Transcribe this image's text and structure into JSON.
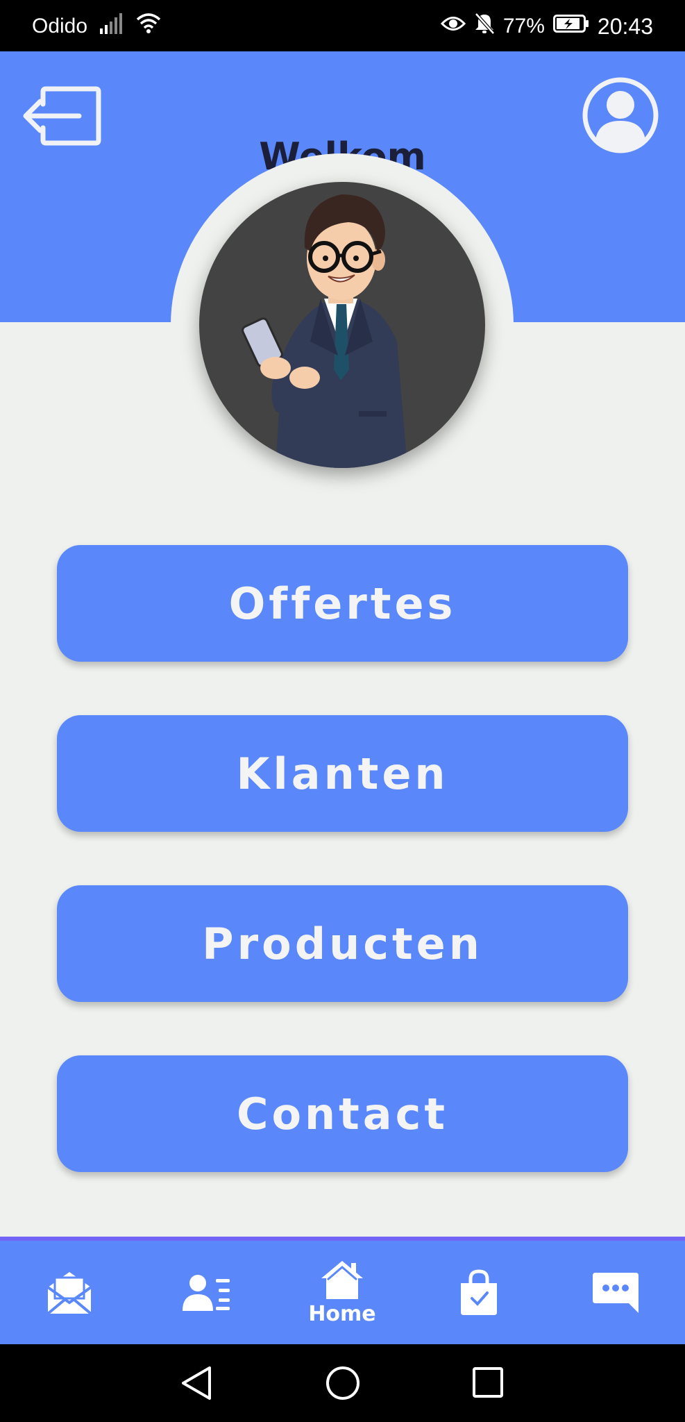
{
  "status_bar": {
    "carrier": "Odido",
    "battery": "77%",
    "time": "20:43",
    "icons": [
      "signal-icon",
      "wifi-icon",
      "eye-icon",
      "bell-off-icon",
      "battery-charging-icon"
    ]
  },
  "header": {
    "title": "Welkom",
    "logout_icon": "logout-icon",
    "profile_icon": "profile-icon",
    "background": "#5a88fa"
  },
  "menu": {
    "items": [
      {
        "label": "Offertes"
      },
      {
        "label": "Klanten"
      },
      {
        "label": "Producten"
      },
      {
        "label": "Contact"
      }
    ]
  },
  "bottom_nav": {
    "items": [
      {
        "icon": "mail-open-icon",
        "label": ""
      },
      {
        "icon": "contacts-list-icon",
        "label": ""
      },
      {
        "icon": "home-icon",
        "label": "Home",
        "active": true
      },
      {
        "icon": "shopping-bag-check-icon",
        "label": ""
      },
      {
        "icon": "chat-bubble-icon",
        "label": ""
      }
    ],
    "accent": "#7264f5"
  },
  "system_nav": {
    "icons": [
      "back-icon",
      "home-circle-icon",
      "recents-icon"
    ]
  }
}
